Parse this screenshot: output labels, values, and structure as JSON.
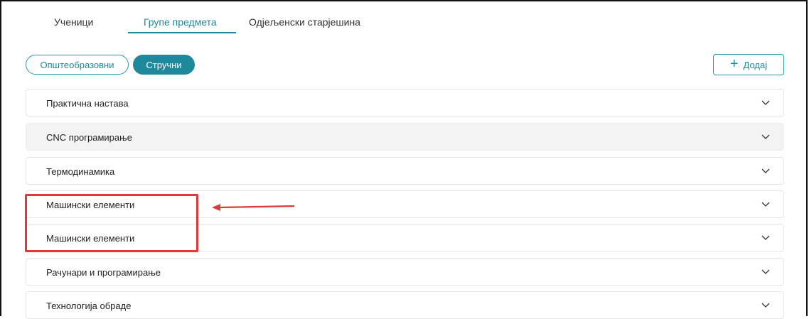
{
  "tabs": [
    {
      "label": "Ученици",
      "active": false
    },
    {
      "label": "Групе предмета",
      "active": true
    },
    {
      "label": "Одјељенски старјешина",
      "active": false
    }
  ],
  "filters": [
    {
      "label": "Општеобразовни",
      "selected": false
    },
    {
      "label": "Стручни",
      "selected": true
    }
  ],
  "add_button": {
    "icon": "plus-icon",
    "label": "Додај"
  },
  "subjects": [
    {
      "label": "Практична настава"
    },
    {
      "label": "CNC програмирање"
    },
    {
      "label": "Термодинамика"
    },
    {
      "label": "Машински елементи"
    },
    {
      "label": "Машински елементи"
    },
    {
      "label": "Рачунари и програмирање"
    },
    {
      "label": "Технологија обраде"
    }
  ],
  "colors": {
    "accent": "#1f8a9c",
    "annotation": "#e0393b",
    "row_highlight": "#f3f3f3"
  }
}
